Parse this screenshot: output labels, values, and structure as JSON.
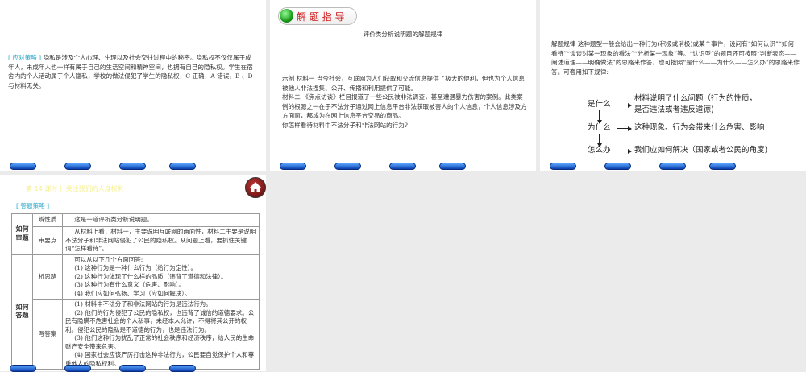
{
  "slide1": {
    "label": "[ 应对策略 ]",
    "text": "隐私是涉及个人心理、生理以及社会交往过程中的秘密。隐私权不仅仅属于成年人，未成年人也一样有属于自己的生活空间和精神空间，也拥有自己的隐私权。学生在宿舍内的个人活动属于个人隐私，学校的做法侵犯了学生的隐私权，C 正确，A 错误，B 、D 与材料无关。"
  },
  "slide2": {
    "badge": "解 题 指 导",
    "title": "评价类分析说明题的解题规律",
    "paragraphs": [
      "示例  材料一   当今社会，互联网为人们获取和交流信息提供了极大的便利，但也为个人信息被他人非法搜集、公开、传播和利用提供了可能。",
      "材料二   《焦点访谈》栏目报道了一些公民被非法调查，甚至遭遇暴力伤害的案例。此类案例的根源之一在于不法分子通过网上信息平台非法获取被害人的个人信息，个人信息涉及方方面面，都成为在网上信息平台交易的商品。",
      "你怎样看待材料中不法分子和非法网站的行为?"
    ]
  },
  "slide3": {
    "text": "解题规律  这种题型一般会给出一种行为(积极或消极)或某个事件，设问有“如何认识”“如何看待”“谈谈对某一现象的看法”“分析某一现象”等。“认识型”的题目还可按照“判断表态——阐述道理——明确做法”的思路来作答，也可按照“是什么——为什么——怎么办”的思路来作答。可套用如下规律:",
    "steps": [
      {
        "q": "是什么",
        "a": "材料说明了什么问题（行为的性质，",
        "a2": "是否违法或者违反道德)"
      },
      {
        "q": "为什么",
        "a": "这种现象、行为会带来什么危害、影响"
      },
      {
        "q": "怎么办",
        "a": "我们应如何解决（国家或者公民的角度)"
      }
    ]
  },
  "slide4": {
    "title": "第 14 课时丨 关注我们的人身权利",
    "label": "[ 答题策略 ]",
    "group1": "如何审题",
    "group2": "如何答题",
    "rows": [
      {
        "step": "辨性质",
        "lines": [
          "这是一道评析类分析说明题。"
        ]
      },
      {
        "step": "审要点",
        "lines": [
          "从材料上看，材料一，主要说明互联网的两面性，材料二主要是说明不法分子和非法网站侵犯了公民的隐私权。从问题上看，要抓住关键词“怎样看待”。"
        ]
      },
      {
        "step": "析思路",
        "lines": [
          "可以从以下几个方面回答:",
          "(1) 这种行为是一种什么行为（给行为定性）。",
          "(2) 这种行为体现了什么样的品质（违背了道德和法律）。",
          "(3) 这种行为有什么意义（危害、影响）。",
          "(4) 我们应如何弘扬、学习（应如何解决）。"
        ]
      },
      {
        "step": "写答案",
        "lines": [
          "(1) 材料中不法分子和非法网站的行为是违法行为。",
          "(2) 他们的行为侵犯了公民的隐私权，也违背了诚信的道德要求。公民有隐瞒不危害社会的个人私事，未经本人允许，不得将其公开的权利。侵犯公民的隐私是不道德的行为，也是违法行为。",
          "(3) 他们这种行为扰乱了正常的社会秩序和经济秩序，给人民的生命财产安全带来危害。",
          "(4) 国家社会应该严厉打击这种非法行为，公民要自觉保护个人和尊重他人的隐私权利。"
        ]
      }
    ]
  },
  "colors": {
    "accent": "#2aa7c9",
    "title": "#f5f08a",
    "badge": "#d0191b"
  }
}
